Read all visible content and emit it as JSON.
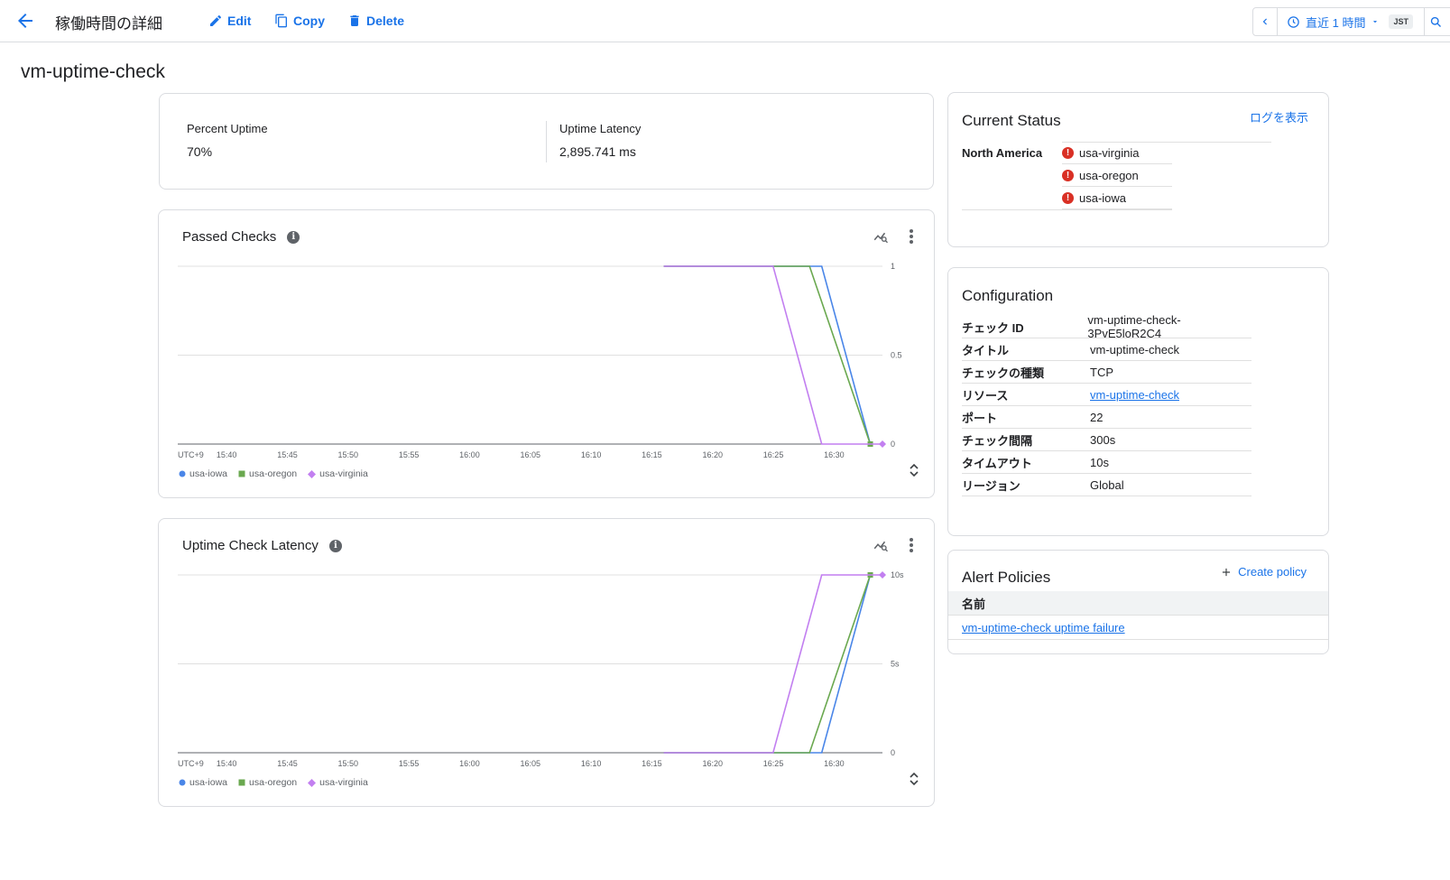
{
  "header": {
    "title": "稼働時間の詳細",
    "edit_label": "Edit",
    "copy_label": "Copy",
    "delete_label": "Delete",
    "time_range_label": "直近 1 時間",
    "timezone": "JST"
  },
  "check_name": "vm-uptime-check",
  "summary": {
    "percent_uptime_label": "Percent Uptime",
    "percent_uptime_value": "70%",
    "latency_label": "Uptime Latency",
    "latency_value": "2,895.741 ms"
  },
  "legend": {
    "iowa": "usa-iowa",
    "oregon": "usa-oregon",
    "virginia": "usa-virginia"
  },
  "colors": {
    "iowa": "#4a86e8",
    "oregon": "#6aa84f",
    "virginia": "#c27ff0",
    "accent": "#1a73e8",
    "error": "#d93025"
  },
  "chart_data": [
    {
      "type": "line",
      "title": "Passed Checks",
      "x_ticks": [
        "UTC+9",
        "15:40",
        "15:45",
        "15:50",
        "15:55",
        "16:00",
        "16:05",
        "16:10",
        "16:15",
        "16:20",
        "16:25",
        "16:30"
      ],
      "y_ticks": [
        "1",
        "0.5",
        "0"
      ],
      "ylim": [
        0,
        1
      ],
      "xlim": [
        "15:36",
        "16:34"
      ],
      "series": [
        {
          "name": "usa-iowa",
          "color": "#4a86e8",
          "points": [
            [
              "16:16",
              1
            ],
            [
              "16:29",
              1
            ],
            [
              "16:33",
              0
            ]
          ]
        },
        {
          "name": "usa-oregon",
          "color": "#6aa84f",
          "points": [
            [
              "16:16",
              1
            ],
            [
              "16:28",
              1
            ],
            [
              "16:33",
              0
            ]
          ]
        },
        {
          "name": "usa-virginia",
          "color": "#c27ff0",
          "points": [
            [
              "16:16",
              1
            ],
            [
              "16:25",
              1
            ],
            [
              "16:29",
              0
            ],
            [
              "16:34",
              0
            ]
          ]
        }
      ]
    },
    {
      "type": "line",
      "title": "Uptime Check Latency",
      "x_ticks": [
        "UTC+9",
        "15:40",
        "15:45",
        "15:50",
        "15:55",
        "16:00",
        "16:05",
        "16:10",
        "16:15",
        "16:20",
        "16:25",
        "16:30"
      ],
      "y_ticks": [
        "10s",
        "5s",
        "0"
      ],
      "ylim": [
        0,
        10
      ],
      "xlim": [
        "15:36",
        "16:34"
      ],
      "series": [
        {
          "name": "usa-iowa",
          "color": "#4a86e8",
          "points": [
            [
              "16:16",
              0
            ],
            [
              "16:29",
              0
            ],
            [
              "16:33",
              10
            ]
          ]
        },
        {
          "name": "usa-oregon",
          "color": "#6aa84f",
          "points": [
            [
              "16:16",
              0
            ],
            [
              "16:28",
              0
            ],
            [
              "16:33",
              10
            ]
          ]
        },
        {
          "name": "usa-virginia",
          "color": "#c27ff0",
          "points": [
            [
              "16:16",
              0
            ],
            [
              "16:25",
              0
            ],
            [
              "16:29",
              10
            ],
            [
              "16:34",
              10
            ]
          ]
        }
      ]
    }
  ],
  "current_status": {
    "title": "Current Status",
    "logs_link": "ログを表示",
    "region": "North America",
    "locations": [
      "usa-virginia",
      "usa-oregon",
      "usa-iowa"
    ]
  },
  "configuration": {
    "title": "Configuration",
    "rows": [
      {
        "key": "チェック ID",
        "value": "vm-uptime-check-3PvE5loR2C4"
      },
      {
        "key": "タイトル",
        "value": "vm-uptime-check"
      },
      {
        "key": "チェックの種類",
        "value": "TCP"
      },
      {
        "key": "リソース",
        "value": "vm-uptime-check"
      },
      {
        "key": "ポート",
        "value": "22"
      },
      {
        "key": "チェック間隔",
        "value": "300s"
      },
      {
        "key": "タイムアウト",
        "value": "10s"
      },
      {
        "key": "リージョン",
        "value": "Global"
      }
    ]
  },
  "alert_policies": {
    "title": "Alert Policies",
    "create_label": "Create policy",
    "column_name": "名前",
    "policy": "vm-uptime-check uptime failure"
  }
}
